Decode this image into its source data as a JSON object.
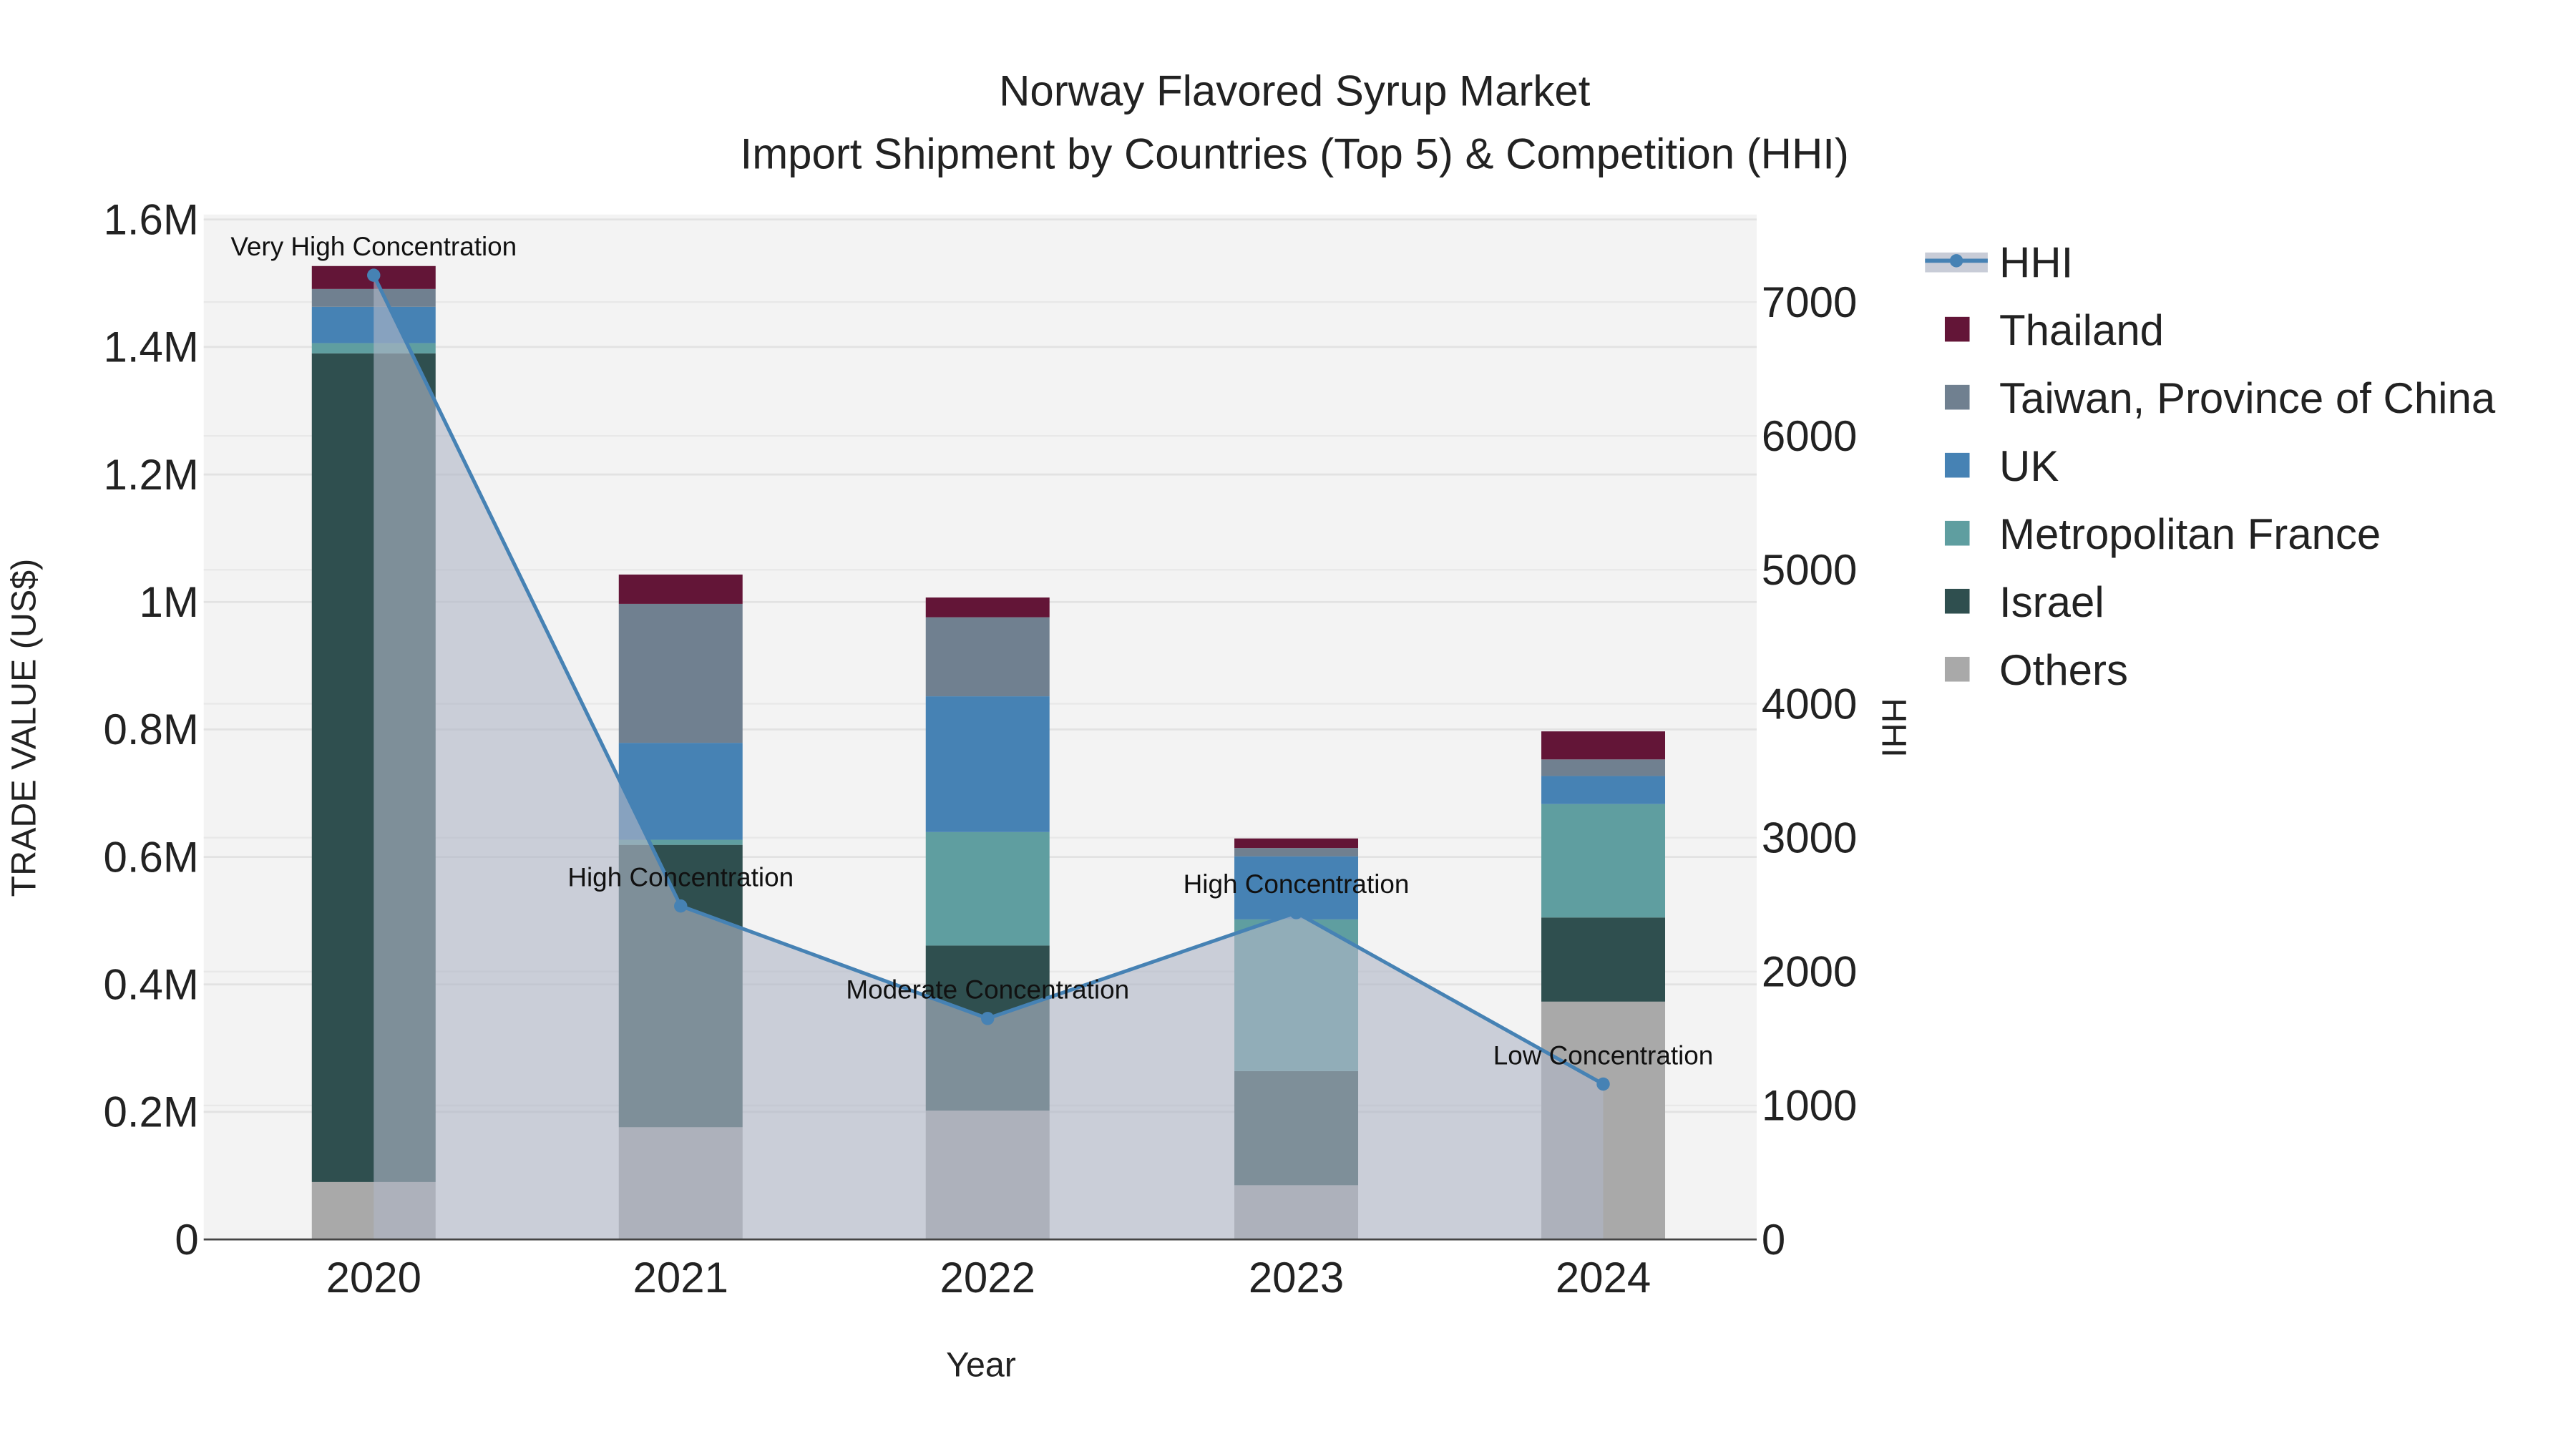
{
  "chart_data": {
    "type": "bar",
    "stacked": true,
    "title": "Norway Flavored Syrup Market",
    "subtitle": "Import Shipment by Countries (Top 5) & Competition (HHI)",
    "xlabel": "Year",
    "ylabel": "TRADE VALUE (US$)",
    "y2label": "HHI",
    "categories": [
      "2020",
      "2021",
      "2022",
      "2023",
      "2024"
    ],
    "ylim": [
      0,
      1600000
    ],
    "y2lim": [
      0,
      7600
    ],
    "yticks": [
      {
        "v": 0,
        "label": "0"
      },
      {
        "v": 200000,
        "label": "0.2M"
      },
      {
        "v": 400000,
        "label": "0.4M"
      },
      {
        "v": 600000,
        "label": "0.6M"
      },
      {
        "v": 800000,
        "label": "0.8M"
      },
      {
        "v": 1000000,
        "label": "1M"
      },
      {
        "v": 1200000,
        "label": "1.2M"
      },
      {
        "v": 1400000,
        "label": "1.4M"
      },
      {
        "v": 1600000,
        "label": "1.6M"
      }
    ],
    "y2ticks": [
      {
        "v": 0,
        "label": "0"
      },
      {
        "v": 1000,
        "label": "1000"
      },
      {
        "v": 2000,
        "label": "2000"
      },
      {
        "v": 3000,
        "label": "3000"
      },
      {
        "v": 4000,
        "label": "4000"
      },
      {
        "v": 5000,
        "label": "5000"
      },
      {
        "v": 6000,
        "label": "6000"
      },
      {
        "v": 7000,
        "label": "7000"
      }
    ],
    "series": [
      {
        "name": "Others",
        "color": "#a9a9a9",
        "values": [
          90000,
          176000,
          202000,
          85000,
          373000
        ]
      },
      {
        "name": "Israel",
        "color": "#2f4f4f",
        "values": [
          1300000,
          443000,
          259000,
          179000,
          132000
        ]
      },
      {
        "name": "Metropolitan France",
        "color": "#5f9ea0",
        "values": [
          16000,
          8000,
          178000,
          238000,
          178000
        ]
      },
      {
        "name": "UK",
        "color": "#4682b4",
        "values": [
          57000,
          152000,
          213000,
          99000,
          44000
        ]
      },
      {
        "name": "Taiwan, Province of China",
        "color": "#708090",
        "values": [
          28000,
          218000,
          124000,
          13000,
          26000
        ]
      },
      {
        "name": "Thailand",
        "color": "#631537",
        "values": [
          36000,
          46000,
          31000,
          15000,
          44000
        ]
      }
    ],
    "hhi": {
      "name": "HHI",
      "color": "#4682b4",
      "values": [
        7200,
        2490,
        1650,
        2440,
        1160
      ],
      "annotations": [
        "Very High Concentration",
        "High Concentration",
        "Moderate Concentration",
        "High Concentration",
        "Low Concentration"
      ]
    },
    "legend_position": "right",
    "grid": true
  }
}
